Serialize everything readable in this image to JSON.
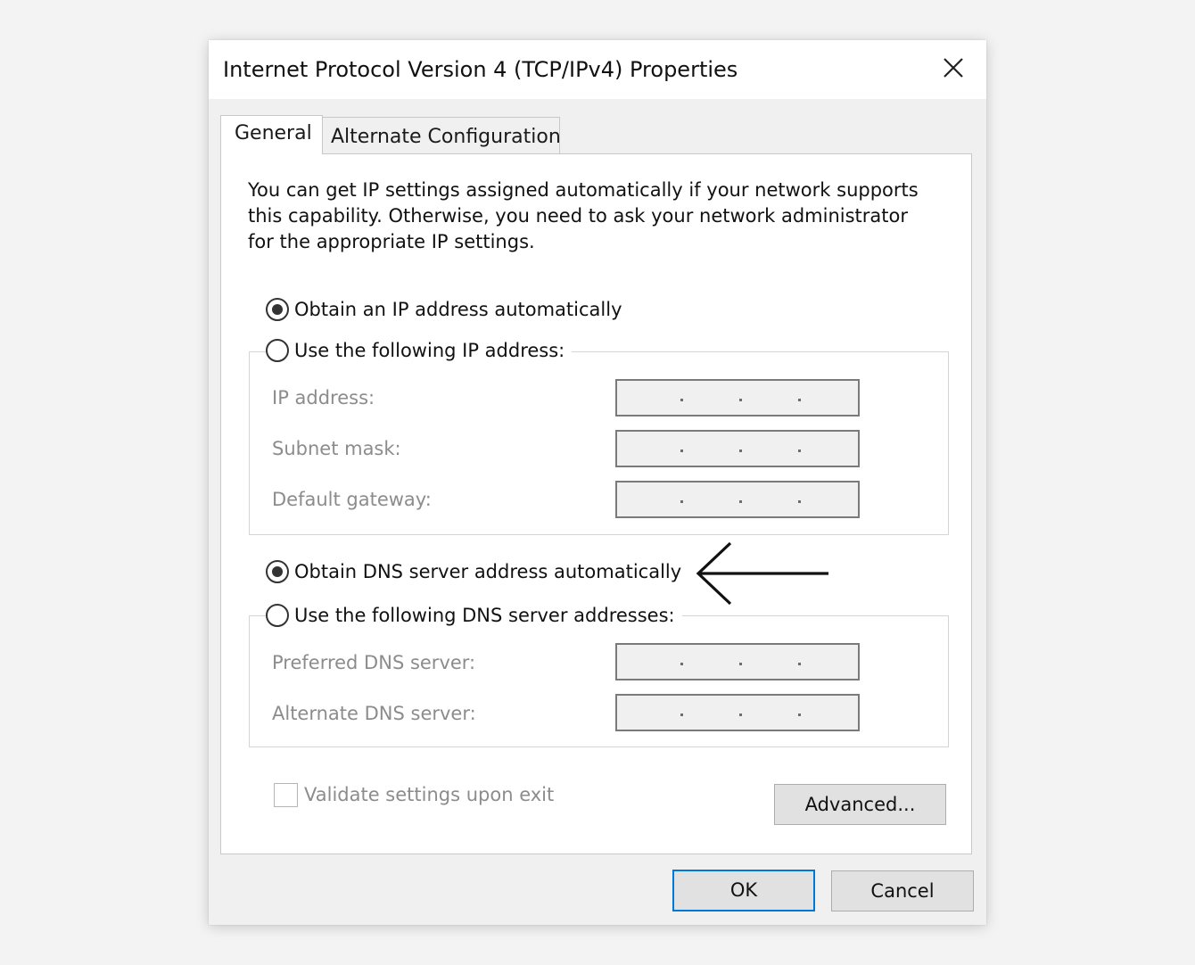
{
  "window": {
    "title": "Internet Protocol Version 4 (TCP/IPv4) Properties",
    "close_icon": "close-icon"
  },
  "tabs": [
    {
      "label": "General",
      "selected": true
    },
    {
      "label": "Alternate Configuration",
      "selected": false
    }
  ],
  "description": {
    "lines": [
      "You can get IP settings assigned automatically if your network supports",
      "this capability. Otherwise, you need to ask your network administrator",
      "for the appropriate IP settings."
    ]
  },
  "ip": {
    "auto_label": "Obtain an IP address automatically",
    "auto_selected": true,
    "manual_label": "Use the following IP address:",
    "manual_selected": false,
    "fields": [
      {
        "label": "IP address:",
        "value": "   .   .   ."
      },
      {
        "label": "Subnet mask:",
        "value": "   .   .   ."
      },
      {
        "label": "Default gateway:",
        "value": "   .   .   ."
      }
    ]
  },
  "dns": {
    "auto_label": "Obtain DNS server address automatically",
    "auto_selected": true,
    "manual_label": "Use the following DNS server addresses:",
    "manual_selected": false,
    "fields": [
      {
        "label": "Preferred DNS server:",
        "value": "   .   .   ."
      },
      {
        "label": "Alternate DNS server:",
        "value": "   .   .   ."
      }
    ]
  },
  "annotation": {
    "arrow_icon": "left-arrow-icon"
  },
  "validate": {
    "label": "Validate settings upon exit",
    "checked": false
  },
  "buttons": {
    "advanced": "Advanced...",
    "ok": "OK",
    "cancel": "Cancel"
  },
  "colors": {
    "accent": "#0078d7",
    "disabled_text": "#8c8c8c"
  }
}
